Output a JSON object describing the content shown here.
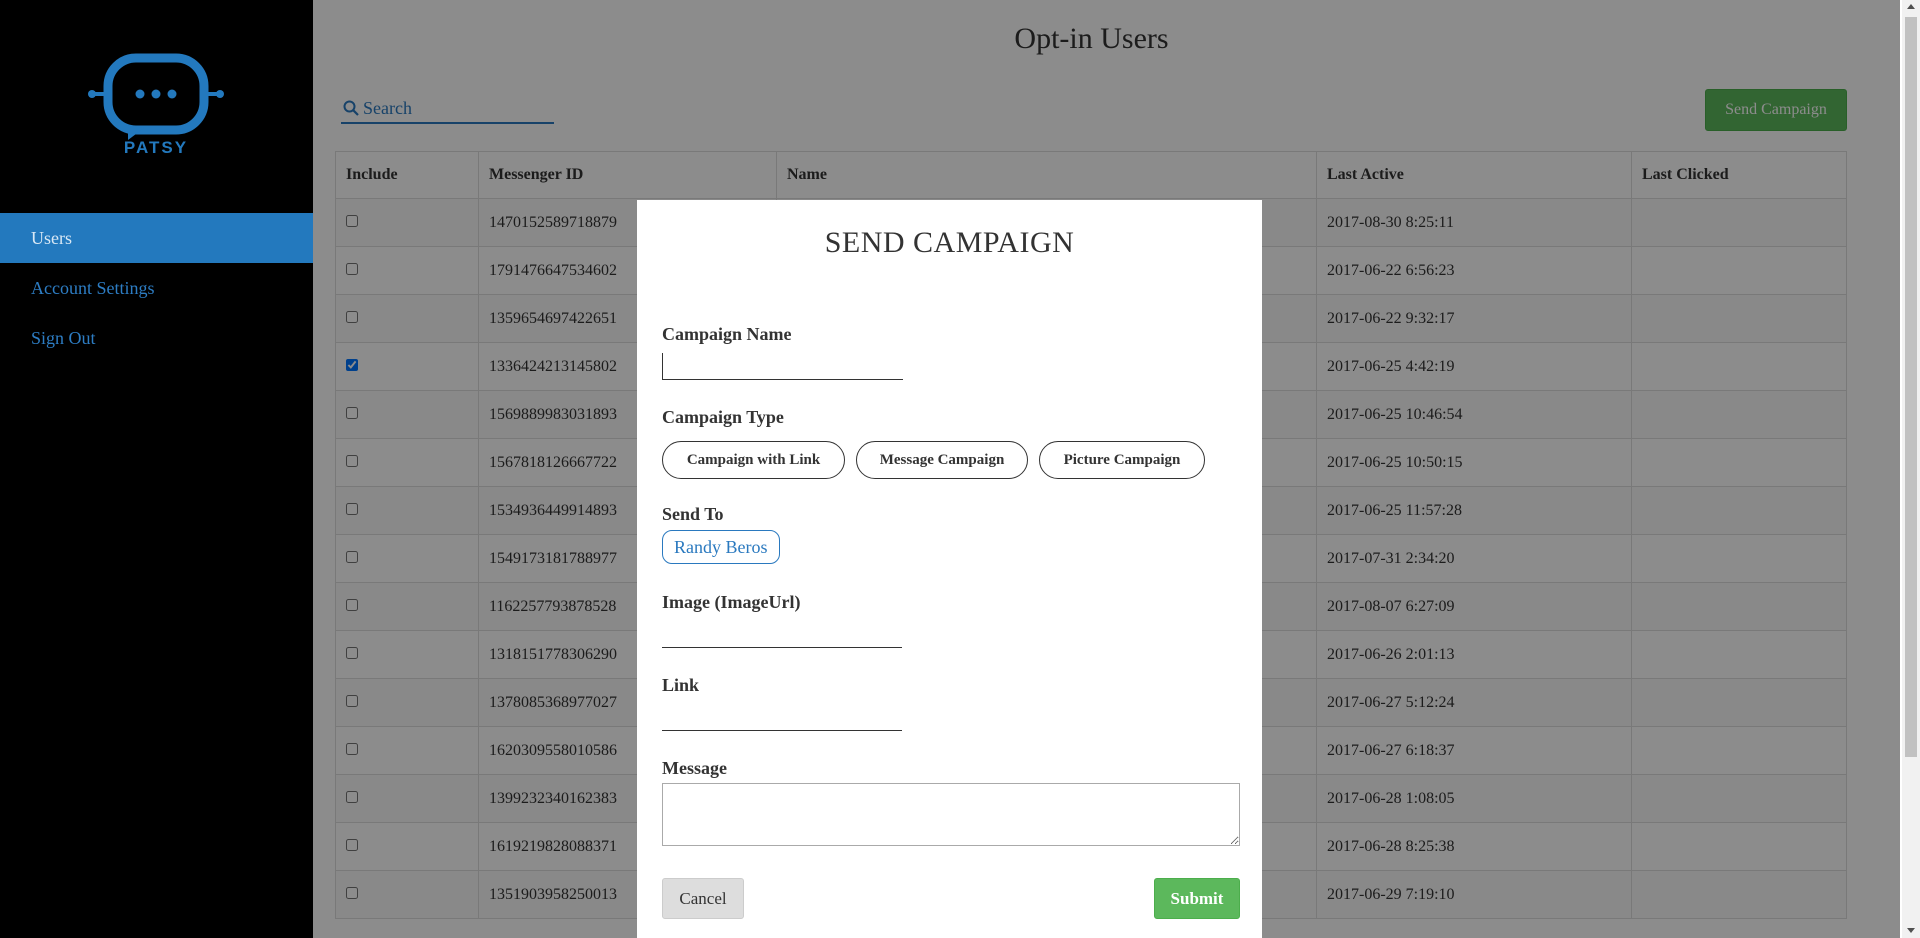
{
  "brand": {
    "name": "PATSY",
    "color": "#2379be"
  },
  "sidebar": {
    "items": [
      {
        "label": "Users",
        "active": true
      },
      {
        "label": "Account Settings",
        "active": false
      },
      {
        "label": "Sign Out",
        "active": false
      }
    ]
  },
  "header": {
    "title": "Opt-in Users",
    "search": {
      "placeholder": "Search",
      "value": ""
    },
    "send_campaign_label": "Send Campaign"
  },
  "table": {
    "columns": [
      "Include",
      "Messenger ID",
      "Name",
      "Last Active",
      "Last Clicked"
    ],
    "rows": [
      {
        "checked": false,
        "messenger_id": "1470152589718879",
        "name": "",
        "last_active": "2017-08-30 8:25:11",
        "last_clicked": ""
      },
      {
        "checked": false,
        "messenger_id": "1791476647534602",
        "name": "",
        "last_active": "2017-06-22 6:56:23",
        "last_clicked": ""
      },
      {
        "checked": false,
        "messenger_id": "1359654697422651",
        "name": "",
        "last_active": "2017-06-22 9:32:17",
        "last_clicked": ""
      },
      {
        "checked": true,
        "messenger_id": "1336424213145802",
        "name": "",
        "last_active": "2017-06-25 4:42:19",
        "last_clicked": ""
      },
      {
        "checked": false,
        "messenger_id": "1569889983031893",
        "name": "",
        "last_active": "2017-06-25 10:46:54",
        "last_clicked": ""
      },
      {
        "checked": false,
        "messenger_id": "1567818126667722",
        "name": "",
        "last_active": "2017-06-25 10:50:15",
        "last_clicked": ""
      },
      {
        "checked": false,
        "messenger_id": "1534936449914893",
        "name": "",
        "last_active": "2017-06-25 11:57:28",
        "last_clicked": ""
      },
      {
        "checked": false,
        "messenger_id": "1549173181788977",
        "name": "",
        "last_active": "2017-07-31 2:34:20",
        "last_clicked": ""
      },
      {
        "checked": false,
        "messenger_id": "1162257793878528",
        "name": "",
        "last_active": "2017-08-07 6:27:09",
        "last_clicked": ""
      },
      {
        "checked": false,
        "messenger_id": "1318151778306290",
        "name": "",
        "last_active": "2017-06-26 2:01:13",
        "last_clicked": ""
      },
      {
        "checked": false,
        "messenger_id": "1378085368977027",
        "name": "",
        "last_active": "2017-06-27 5:12:24",
        "last_clicked": ""
      },
      {
        "checked": false,
        "messenger_id": "1620309558010586",
        "name": "",
        "last_active": "2017-06-27 6:18:37",
        "last_clicked": ""
      },
      {
        "checked": false,
        "messenger_id": "1399232340162383",
        "name": "",
        "last_active": "2017-06-28 1:08:05",
        "last_clicked": ""
      },
      {
        "checked": false,
        "messenger_id": "1619219828088371",
        "name": "",
        "last_active": "2017-06-28 8:25:38",
        "last_clicked": ""
      },
      {
        "checked": false,
        "messenger_id": "1351903958250013",
        "name": "",
        "last_active": "2017-06-29 7:19:10",
        "last_clicked": ""
      }
    ]
  },
  "modal": {
    "title": "SEND CAMPAIGN",
    "campaign_name": {
      "label": "Campaign Name",
      "value": ""
    },
    "campaign_type": {
      "label": "Campaign Type",
      "options": [
        "Campaign with Link",
        "Message Campaign",
        "Picture Campaign"
      ]
    },
    "send_to": {
      "label": "Send To",
      "recipients": [
        "Randy Beros"
      ]
    },
    "image_url": {
      "label": "Image (ImageUrl)",
      "value": ""
    },
    "link": {
      "label": "Link",
      "value": ""
    },
    "message": {
      "label": "Message",
      "value": ""
    },
    "cancel_label": "Cancel",
    "submit_label": "Submit"
  },
  "colors": {
    "primary": "#2379be",
    "success": "#5cb85c",
    "sidebar_bg": "#000000"
  },
  "icons": {
    "search": "search-icon",
    "logo": "robot-chat-logo"
  }
}
